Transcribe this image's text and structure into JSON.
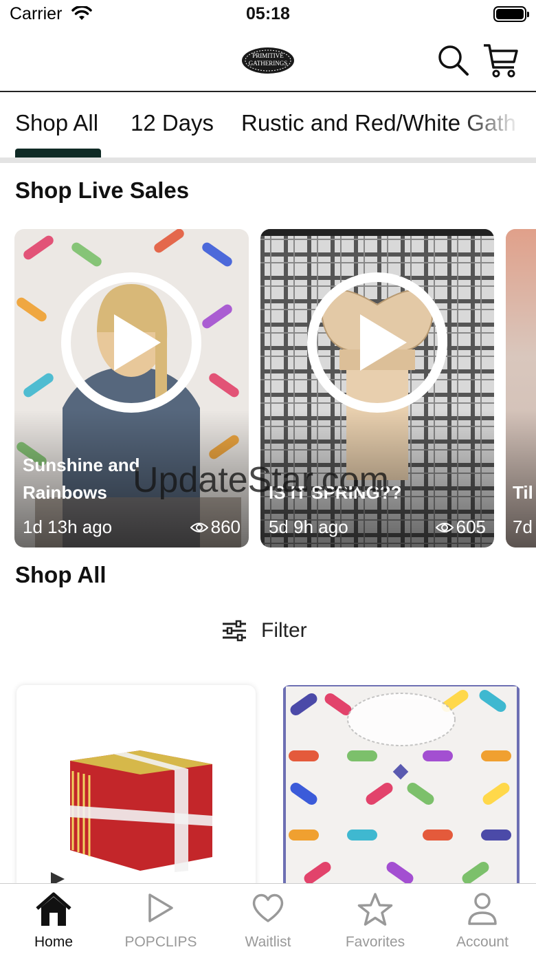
{
  "status_bar": {
    "carrier": "Carrier",
    "time": "05:18"
  },
  "header": {
    "logo_line1": "PRIMITIVE",
    "logo_line2": "GATHERINGS"
  },
  "tabs": [
    {
      "label": "Shop All",
      "active": true
    },
    {
      "label": "12 Days"
    },
    {
      "label": "Rustic and Red/White Gath"
    }
  ],
  "live_section": {
    "title": "Shop Live Sales",
    "cards": [
      {
        "name": "Sunshine and Rainbows",
        "age": "1d 13h ago",
        "views": "860"
      },
      {
        "name": "IS IT SPRING??",
        "age": "5d 9h ago",
        "views": "605"
      },
      {
        "name": "Til",
        "age": "7d"
      }
    ]
  },
  "watermark": "UpdateStar.com",
  "shop_all": {
    "title": "Shop All",
    "filter_label": "Filter"
  },
  "bottom_nav": [
    {
      "label": "Home",
      "icon": "home-icon",
      "active": true
    },
    {
      "label": "POPCLIPS",
      "icon": "play-icon"
    },
    {
      "label": "Waitlist",
      "icon": "heart-icon"
    },
    {
      "label": "Favorites",
      "icon": "star-icon"
    },
    {
      "label": "Account",
      "icon": "person-icon"
    }
  ],
  "colors": {
    "accent": "#0f2a25",
    "inactive": "#999999"
  }
}
